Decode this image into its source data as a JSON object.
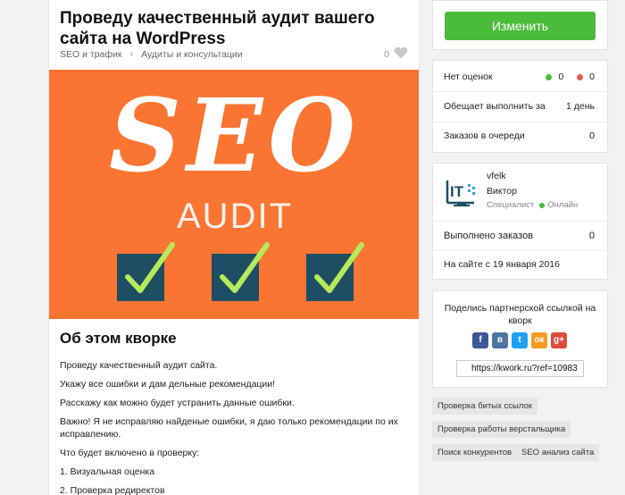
{
  "kwork": {
    "title": "Проведу качественный аудит вашего сайта на WordPress",
    "breadcrumb": [
      "SEO и трафик",
      "Аудиты и консультации"
    ],
    "likes": "0",
    "banner": {
      "big": "SEO",
      "small": "AUDIT"
    }
  },
  "about": {
    "heading": "Об этом кворке",
    "paragraphs": [
      "Проведу качественный аудит сайта.",
      "Укажу все ошибки и дам дельные рекомендации!",
      "Расскажу как можно будет устранить данные ошибки.",
      "Важно! Я не исправляю найденые ошибки, я даю только рекомендации по их исправлению.",
      "Что будет включено в проверку:",
      "1. Визуальная оценка",
      "2. Проверка редиректов"
    ]
  },
  "action": {
    "edit_label": "Изменить"
  },
  "stats": {
    "no_ratings": "Нет оценок",
    "positive": "0",
    "negative": "0",
    "promise_label": "Обещает выполнить за",
    "promise_value": "1 день",
    "queue_label": "Заказов в очереди",
    "queue_value": "0"
  },
  "seller": {
    "login": "vfelk",
    "name": "Виктор",
    "role": "Специалист",
    "status": "Онлайн",
    "completed_label": "Выполнено заказов",
    "completed_value": "0",
    "since": "На сайте с 19 января 2016"
  },
  "share": {
    "text": "Поделись партнерской ссылкой на кворк",
    "link": "https://kwork.ru?ref=10983",
    "networks": [
      "facebook-icon",
      "vk-icon",
      "twitter-icon",
      "odnoklassniki-icon",
      "google-plus-icon"
    ]
  },
  "tags": [
    "Проверка битых ссылок",
    "Проверка работы верстальщика",
    "Поиск конкурентов",
    "SEO анализ сайта"
  ],
  "colors": {
    "accent": "#4bbb3b",
    "banner": "#fa7532",
    "checkbox": "#1d4e64"
  }
}
